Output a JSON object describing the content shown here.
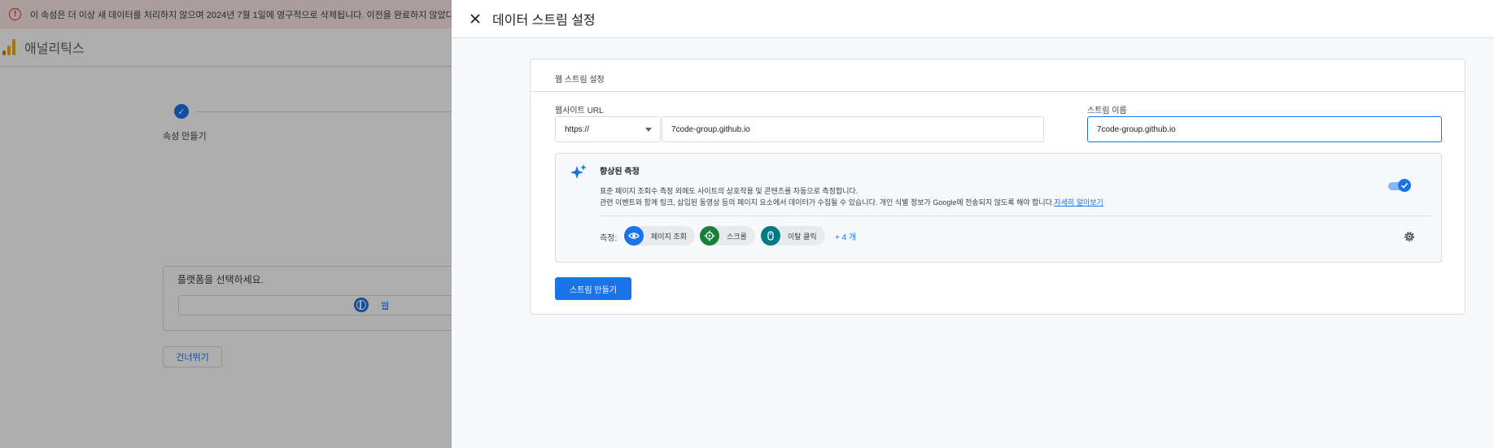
{
  "background": {
    "banner_text": "이 속성은 더 이상 새 데이터를 처리하지 않으며 2024년 7월 1일에 영구적으로 삭제됩니다. 이전을 완료하지 않았다면 설정 이",
    "app_title": "애널리틱스",
    "step_label": "속성 만들기",
    "platform_title": "플랫폼을 선택하세요.",
    "platform_web": "웹",
    "skip_label": "건너뛰기"
  },
  "panel": {
    "title": "데이터 스트림 설정",
    "card_title": "웹 스트림 설정",
    "url_label": "웹사이트 URL",
    "protocol_value": "https://",
    "url_value": "7code-group.github.io",
    "stream_name_label": "스트림 이름",
    "stream_name_value": "7code-group.github.io",
    "enhanced": {
      "title": "향상된 측정",
      "desc_line1": "표준 페이지 조회수 측정 외에도 사이트의 상호작용 및 콘텐츠를 자동으로 측정합니다.",
      "desc_line2": "관련 이벤트와 함께 링크, 삽입된 동영상 등의 페이지 요소에서 데이터가 수집될 수 있습니다. 개인 식별 정보가 Google에 전송되지 않도록 해야 합니다.",
      "learn_more": "자세히 알아보기",
      "toggle_on": true,
      "measure_label": "측정:",
      "chips": [
        {
          "label": "페이지 조회",
          "icon": "eye-icon",
          "color": "#1a73e8"
        },
        {
          "label": "스크롤",
          "icon": "crosshair-icon",
          "color": "#188038"
        },
        {
          "label": "이탈 클릭",
          "icon": "mouse-icon",
          "color": "#007b83"
        }
      ],
      "more_label": "+ 4 개"
    },
    "create_button": "스트림 만들기"
  },
  "colors": {
    "accent": "#1a73e8",
    "banner_bg": "#fce8e6",
    "error": "#d93025"
  }
}
